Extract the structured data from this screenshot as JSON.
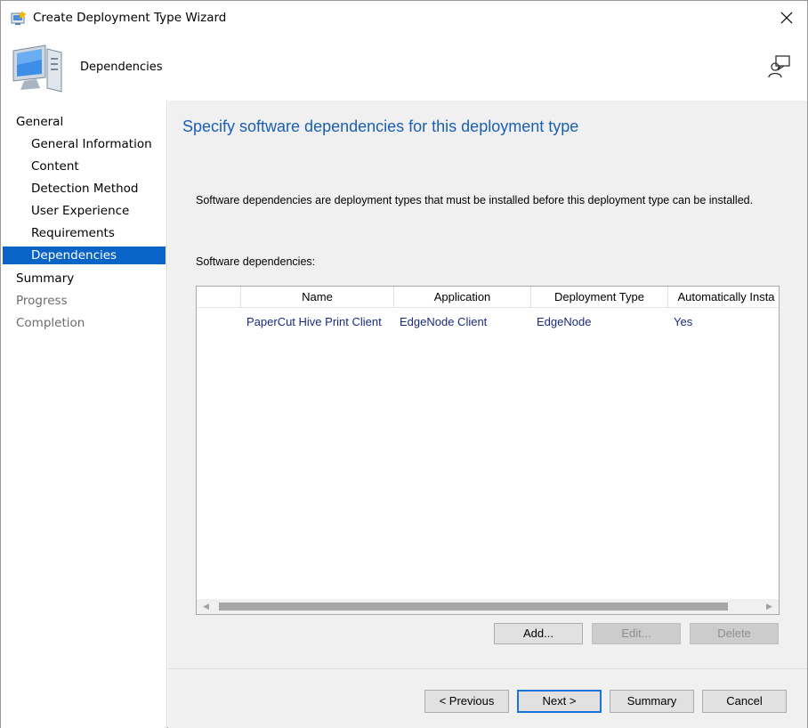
{
  "window": {
    "title": "Create Deployment Type Wizard",
    "close_glyph": "✕"
  },
  "header": {
    "page_name": "Dependencies"
  },
  "sidebar": {
    "items": [
      {
        "label": "General",
        "level": 1,
        "state": "normal"
      },
      {
        "label": "General Information",
        "level": 2,
        "state": "normal"
      },
      {
        "label": "Content",
        "level": 2,
        "state": "normal"
      },
      {
        "label": "Detection Method",
        "level": 2,
        "state": "normal"
      },
      {
        "label": "User Experience",
        "level": 2,
        "state": "normal"
      },
      {
        "label": "Requirements",
        "level": 2,
        "state": "normal"
      },
      {
        "label": "Dependencies",
        "level": 2,
        "state": "active"
      },
      {
        "label": "Summary",
        "level": 1,
        "state": "normal"
      },
      {
        "label": "Progress",
        "level": 1,
        "state": "disabled"
      },
      {
        "label": "Completion",
        "level": 1,
        "state": "disabled"
      }
    ]
  },
  "main": {
    "heading": "Specify software dependencies for this deployment type",
    "description": "Software dependencies are deployment types that must be installed before this deployment type can be installed.",
    "list_label": "Software dependencies:",
    "table": {
      "columns": [
        "",
        "Name",
        "Application",
        "Deployment Type",
        "Automatically Insta"
      ],
      "rows": [
        [
          "",
          "PaperCut Hive Print Client",
          "EdgeNode Client",
          "EdgeNode",
          "Yes"
        ]
      ]
    },
    "scroll_left_glyph": "◀",
    "scroll_right_glyph": "▶",
    "buttons": {
      "add": "Add...",
      "edit": "Edit...",
      "delete": "Delete"
    }
  },
  "footer": {
    "previous": "< Previous",
    "next": "Next >",
    "summary": "Summary",
    "cancel": "Cancel"
  },
  "colors": {
    "accent": "#0a64c8",
    "heading": "#1a5fb4",
    "row_text": "#1a2a80"
  },
  "icons": [
    "wizard-app-icon",
    "computer-icon",
    "help-feedback-icon",
    "close-icon"
  ]
}
